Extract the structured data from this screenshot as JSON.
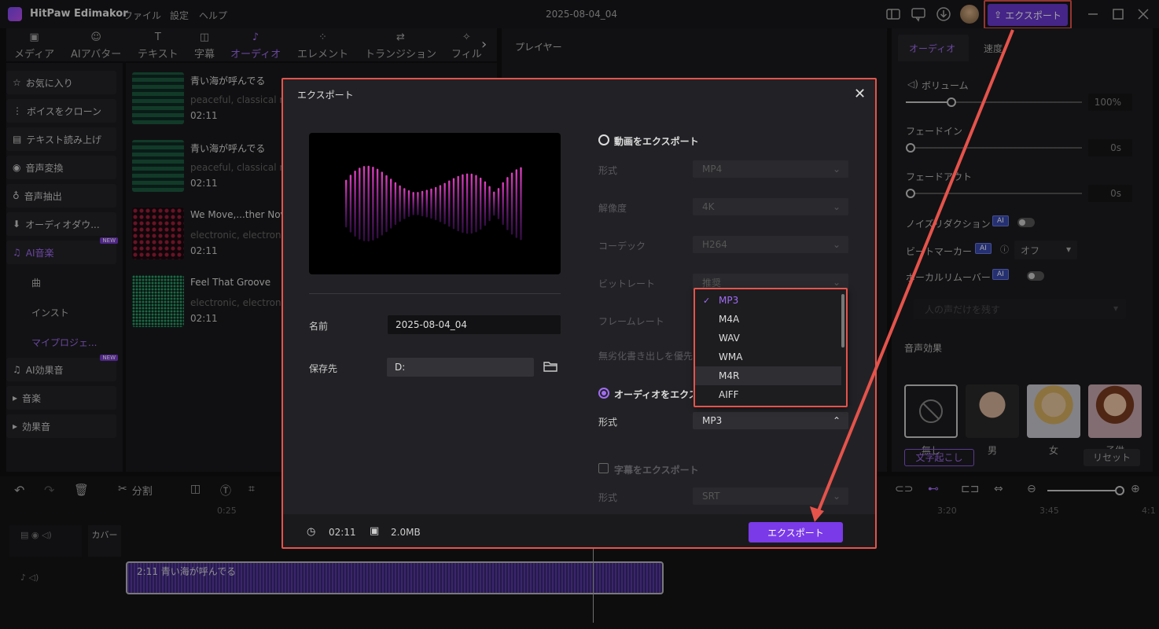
{
  "app": {
    "name": "HitPaw Edimakor",
    "menus": [
      "ファイル",
      "設定",
      "ヘルプ"
    ],
    "doc_title": "2025-08-04_04",
    "export_label": "エクスポート"
  },
  "toolbar": {
    "items": [
      "メディア",
      "AIアバター",
      "テキスト",
      "字幕",
      "オーディオ",
      "エレメント",
      "トランジション",
      "フィル"
    ]
  },
  "sidebar": {
    "items": [
      "お気に入り",
      "ボイスをクローン",
      "テキスト読み上げ",
      "音声変換",
      "音声抽出",
      "オーディオダウ...",
      "AI音楽"
    ],
    "subitems": [
      "曲",
      "インスト",
      "マイプロジェ..."
    ],
    "items2": [
      "AI効果音",
      "音楽",
      "効果音"
    ],
    "new_badge": "NEW"
  },
  "media": {
    "cards": [
      {
        "title": "青い海が呼んでる",
        "sub": "peaceful, classical m",
        "dur": "02:11"
      },
      {
        "title": "青い海が呼んでる",
        "sub": "peaceful, classical m",
        "dur": "02:11"
      },
      {
        "title": "We Move,...ther Nov",
        "sub": "electronic, electronic",
        "dur": "02:11"
      },
      {
        "title": "Feel That Groove",
        "sub": "electronic, electronic",
        "dur": "02:11"
      }
    ]
  },
  "player": {
    "label": "プレイヤー"
  },
  "right": {
    "tabs": [
      "オーディオ",
      "速度"
    ],
    "volume_label": "ボリューム",
    "volume_value": "100%",
    "fadein_label": "フェードイン",
    "fadein_value": "0s",
    "fadeout_label": "フェードアウト",
    "fadeout_value": "0s",
    "noise_label": "ノイズリダクション",
    "beat_label": "ビートマーカー",
    "beat_value": "オフ",
    "vocal_label": "ボーカルリムーバー",
    "vocal_placeholder": "人の声だけを残す",
    "ai": "AI",
    "effects_label": "音声効果",
    "effects": [
      "無し",
      "男",
      "女",
      "子供"
    ],
    "transcribe": "文字起こし",
    "reset": "リセット"
  },
  "timeline": {
    "split": "分割",
    "ticks": [
      "0:25",
      "3:20",
      "3:45",
      "4:1"
    ],
    "cover": "カバー",
    "clip": "2:11 青い海が呼んでる"
  },
  "dialog": {
    "title": "エクスポート",
    "name_label": "名前",
    "name_value": "2025-08-04_04",
    "save_label": "保存先",
    "save_value": "D:",
    "video_export": "動画をエクスポート",
    "format_label": "形式",
    "format_value": "MP4",
    "resolution_label": "解像度",
    "resolution_value": "4K",
    "codec_label": "コーデック",
    "codec_value": "H264",
    "bitrate_label": "ビットレート",
    "bitrate_value": "推奨",
    "framerate_label": "フレームレート",
    "lossless_label": "無劣化書き出しを優先",
    "audio_export": "オーディオをエクス",
    "audio_format_label": "形式",
    "audio_format_value": "MP3",
    "subtitle_export": "字幕をエクスポート",
    "subtitle_format_label": "形式",
    "subtitle_format_value": "SRT",
    "options": [
      "MP3",
      "M4A",
      "WAV",
      "WMA",
      "M4R",
      "AIFF"
    ],
    "selected_option": "MP3",
    "hovered_option": "M4R",
    "duration": "02:11",
    "size": "2.0MB",
    "export_button": "エクスポート"
  },
  "colors": {
    "accent": "#7a3ae8",
    "highlight": "#e5534b",
    "purple_text": "#a26cf5"
  }
}
